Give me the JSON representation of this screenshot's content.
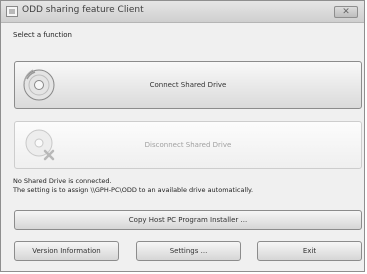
{
  "window": {
    "title": "ODD sharing feature Client",
    "close_glyph": "✕"
  },
  "prompt": "Select a function",
  "connect": {
    "label": "Connect Shared Drive",
    "icon": "disc-icon"
  },
  "disconnect": {
    "label": "Disconnect Shared Drive",
    "icon": "disc-remove-icon"
  },
  "status": {
    "line1": "No Shared Drive is connected.",
    "line2": "The setting is to assign \\\\GPH-PC\\ODD to an available drive automatically."
  },
  "buttons": {
    "installer": "Copy Host PC Program Installer ...",
    "version": "Version Information",
    "settings": "Settings ...",
    "exit": "Exit"
  }
}
